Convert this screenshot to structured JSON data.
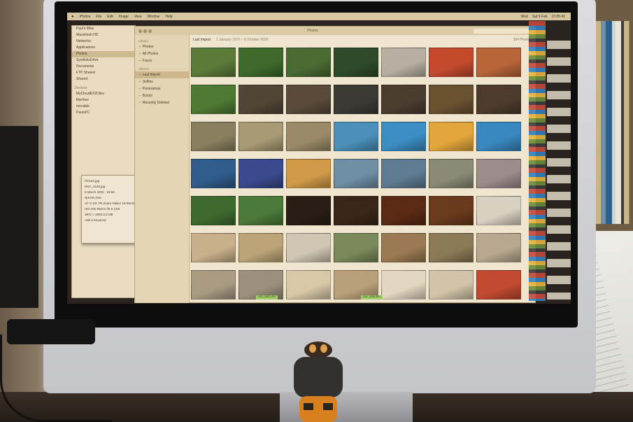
{
  "menubar": {
    "app_items": [
      "Photos",
      "File",
      "Edit",
      "Image",
      "View",
      "Window",
      "Help"
    ],
    "right_items": [
      "Wed",
      "Sat 6 Feb",
      "23:05:43"
    ]
  },
  "finder": {
    "items": [
      "Paul's iMac",
      "Macintosh HD",
      "Networks",
      "Applications",
      "Photos",
      "SymlinksDrive",
      "Documents",
      "FTP Shared",
      "Shared"
    ],
    "selected_index": 4,
    "head_devices": "Devices",
    "devices": [
      "MyCloudEX2Ultra",
      "fiberbox",
      "movable",
      "PaulsPC"
    ]
  },
  "infopanel": {
    "rows": [
      "Picture.jpg",
      "DSC_0160.jpg",
      "6 March 2020 · 18:58",
      "NIKON D40",
      "AF-S DX VR Zoom-Nikkor 18-55mm",
      "ISO 200   55mm   f/5.6   1/60",
      "3872 × 2592   6.8 MB",
      "Add a Keyword"
    ]
  },
  "photos": {
    "window_title": "Photos",
    "sidebar_head_library": "Library",
    "sidebar_head_albums": "Albums",
    "sidebar": [
      {
        "label": "Photos",
        "icon": "photos-icon"
      },
      {
        "label": "All Photos",
        "icon": "grid-icon"
      },
      {
        "label": "Faces",
        "icon": "person-icon"
      },
      {
        "label": "Last Import",
        "icon": "import-icon"
      },
      {
        "label": "Selfies",
        "icon": "camera-icon"
      },
      {
        "label": "Panoramas",
        "icon": "panorama-icon"
      },
      {
        "label": "Bursts",
        "icon": "burst-icon"
      },
      {
        "label": "Recently Deleted",
        "icon": "trash-icon"
      }
    ],
    "sidebar_selected_index": 3,
    "header_title": "Last Import",
    "header_range": "1 January 1970 – 6 October 2020",
    "header_count": "284 Photos"
  },
  "thumb_colors": [
    [
      "#5c7a3a",
      "#3e6a2c",
      "#4a6a33",
      "#2f4a2a",
      "#b7b0a2",
      "#c44a2e",
      "#b8653a"
    ],
    [
      "#4f7a34",
      "#514636",
      "#5a4a3a",
      "#3c3a35",
      "#4a3d30",
      "#6a5230",
      "#4d3c2d"
    ],
    [
      "#8a8060",
      "#a89a74",
      "#9a8a68",
      "#4a90b8",
      "#3b8dc2",
      "#e3a63c",
      "#3a88c0"
    ],
    [
      "#2f5c8a",
      "#3a4a8c",
      "#d19a48",
      "#6f8fa5",
      "#5e7b92",
      "#8a8a76",
      "#9c8c8a"
    ],
    [
      "#3f6a2f",
      "#4c7a3a",
      "#2a1e14",
      "#3a2618",
      "#5a2a14",
      "#6a3a1c",
      "#d8d0c0"
    ],
    [
      "#c8b08a",
      "#bca478",
      "#cfc6b4",
      "#7a8a5a",
      "#9a7a52",
      "#8b7a55",
      "#b8a890"
    ],
    [
      "#a89b82",
      "#9c907c",
      "#d8c8a8",
      "#b8a07a",
      "#e2d6c0",
      "#d2c4a8",
      "#c24a30"
    ]
  ],
  "tags": [
    "DSC_0283.JPG",
    "DSC_0284.JPG"
  ]
}
